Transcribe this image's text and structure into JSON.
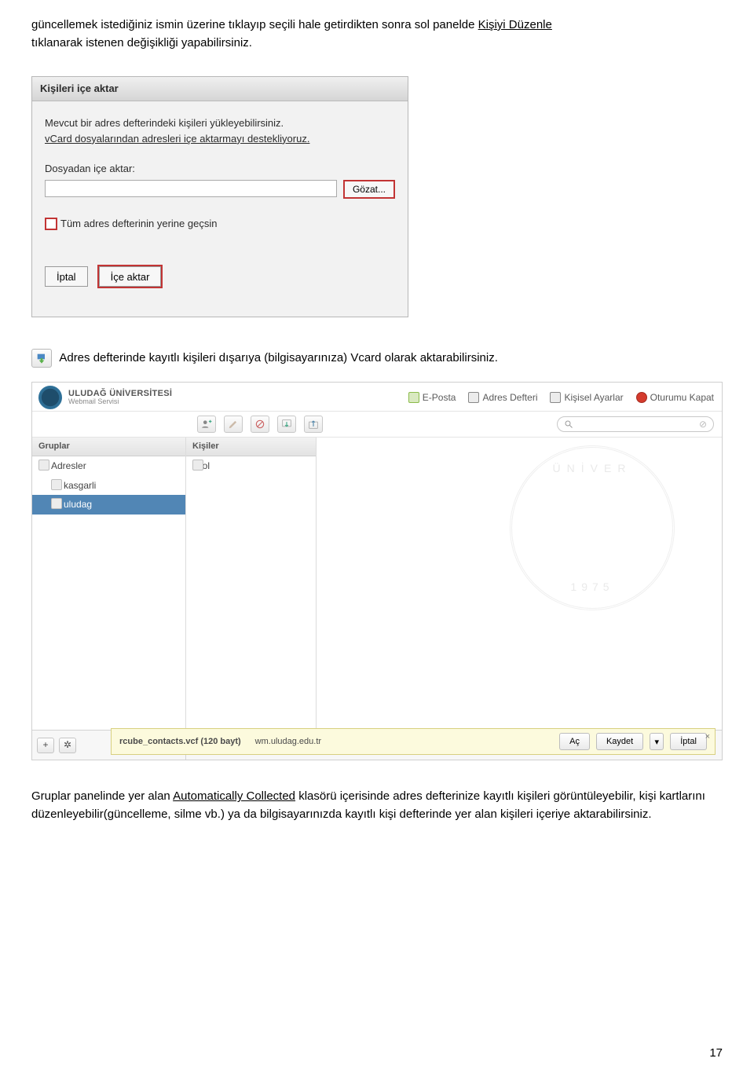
{
  "intro": {
    "line1a": "güncellemek istediğiniz ismin üzerine tıklayıp seçili hale getirdikten sonra sol panelde ",
    "line1b": "Kişiyi Düzenle",
    "line2": "tıklanarak istenen değişikliği yapabilirsiniz."
  },
  "importDialog": {
    "title": "Kişileri içe aktar",
    "desc1": "Mevcut bir adres defterindeki kişileri yükleyebilirsiniz.",
    "desc2": "vCard dosyalarından adresleri içe aktarmayı destekliyoruz.",
    "fileLabel": "Dosyadan içe aktar:",
    "browse": "Gözat...",
    "replace": "Tüm adres defterinin yerine geçsin",
    "cancel": "İptal",
    "import": "İçe aktar"
  },
  "exportLine": {
    "text": "Adres defterinde kayıtlı kişileri dışarıya (bilgisayarınıza) Vcard olarak aktarabilirsiniz."
  },
  "webmail": {
    "brand1": "ULUDAĞ ÜNİVERSİTESİ",
    "brand2": "Webmail Servisi",
    "links": {
      "mail": "E-Posta",
      "book": "Adres Defteri",
      "settings": "Kişisel Ayarlar",
      "logout": "Oturumu Kapat"
    },
    "searchPlaceholder": "",
    "groupsHead": "Gruplar",
    "peopleHead": "Kişiler",
    "groups": [
      "Adresler",
      "kasgarli",
      "uludag"
    ],
    "people": [
      "erol"
    ],
    "watermarkTop": "ÜNİVER",
    "watermarkBot": "1975",
    "download": {
      "filename": "rcube_contacts.vcf (120 bayt)",
      "host": "wm.uludag.edu.tr",
      "open": "Aç",
      "save": "Kaydet",
      "cancel": "İptal"
    },
    "plus": "+",
    "gear": "✲"
  },
  "trailing": {
    "p1a": "Gruplar panelinde yer alan ",
    "p1b": "Automatically Collected",
    "p1c": " klasörü içerisinde adres defterinize kayıtlı kişileri görüntüleyebilir, kişi kartlarını düzenleyebilir(güncelleme, silme vb.) ya da bilgisayarınızda kayıtlı kişi defterinde yer alan kişileri içeriye aktarabilirsiniz."
  },
  "pageNumber": "17"
}
